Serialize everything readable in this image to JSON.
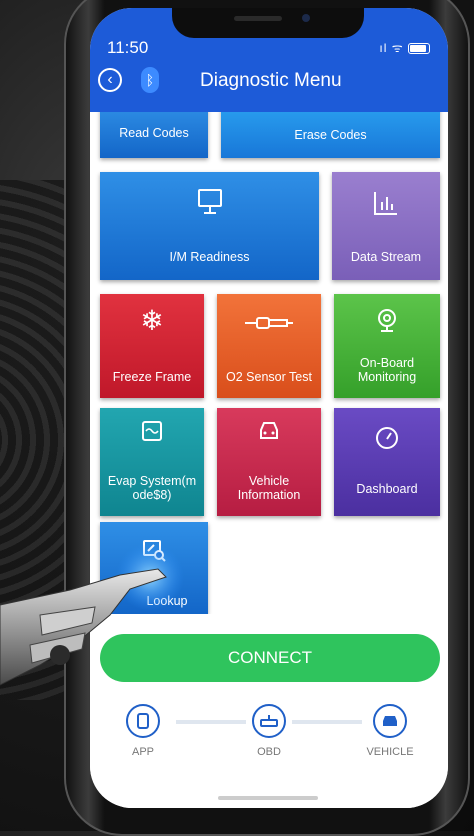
{
  "status_bar": {
    "time": "11:50",
    "signal": "ıl ᯤ"
  },
  "header": {
    "title": "Diagnostic Menu",
    "bluetooth_glyph": "ᛒ",
    "back_glyph": "‹"
  },
  "menu": {
    "read_codes": "Read Codes",
    "erase_codes": "Erase Codes",
    "im_readiness": "I/M Readiness",
    "data_stream": "Data Stream",
    "freeze_frame": "Freeze Frame",
    "o2_sensor_test": "O2 Sensor Test",
    "onboard_monitoring": "On-Board Monitoring",
    "evap_system": "Evap System(m ode$8)",
    "vehicle_information": "Vehicle Information",
    "dashboard": "Dashboard",
    "lookup": "Lookup"
  },
  "connect": {
    "button_label": "CONNECT"
  },
  "steps": {
    "app": "APP",
    "obd": "OBD",
    "vehicle": "VEHICLE"
  },
  "colors": {
    "header": "#1d5bd8",
    "connect": "#2fc45d",
    "step_accent": "#2060c8"
  }
}
